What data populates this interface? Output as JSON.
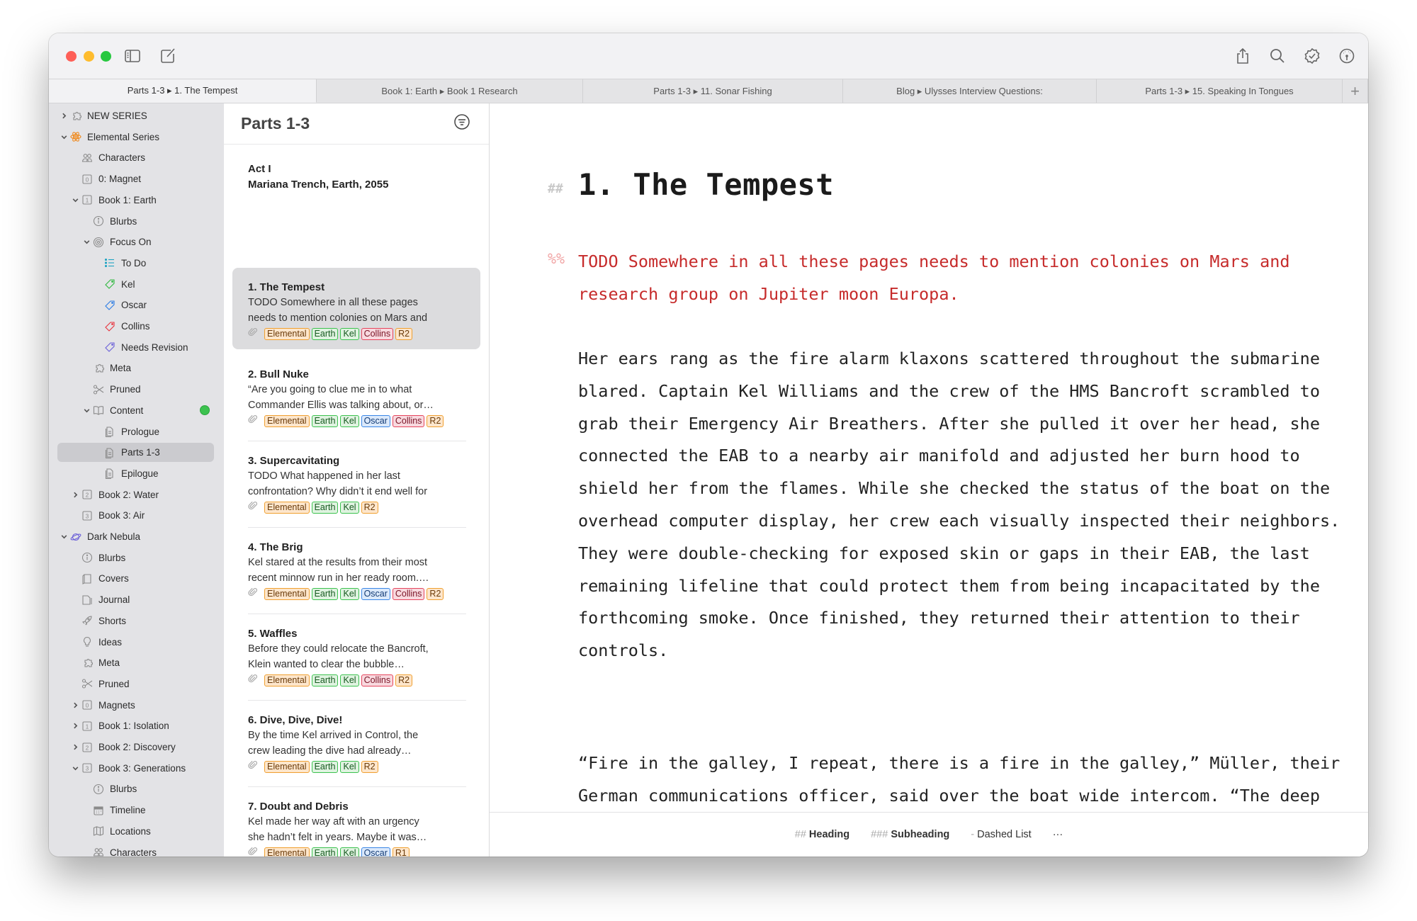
{
  "window": {
    "traffic_lights": [
      "close",
      "minimize",
      "zoom"
    ],
    "toolbar_left": [
      {
        "name": "sidebar-toggle-icon"
      },
      {
        "name": "new-sheet-icon"
      }
    ],
    "toolbar_right": [
      {
        "name": "share-icon"
      },
      {
        "name": "search-icon"
      },
      {
        "name": "review-badge-icon"
      },
      {
        "name": "dashboard-icon"
      }
    ]
  },
  "tabs": [
    {
      "label": "Parts 1-3 ▸ 1. The Tempest",
      "active": true
    },
    {
      "label": "Book 1: Earth ▸ Book 1 Research",
      "active": false
    },
    {
      "label": "Parts 1-3 ▸ 11. Sonar Fishing",
      "active": false
    },
    {
      "label": "Blog ▸ Ulysses Interview Questions:",
      "active": false
    },
    {
      "label": "Parts 1-3 ▸ 15. Speaking In Tongues",
      "active": false
    }
  ],
  "tab_add": "+",
  "sidebar": {
    "items": [
      {
        "label": "NEW SERIES",
        "level": 0,
        "chevron": "right",
        "icon": "puzzle",
        "color": "#8a8a8a"
      },
      {
        "label": "Elemental Series",
        "level": 0,
        "chevron": "down",
        "icon": "atom",
        "color": "#f08a1e"
      },
      {
        "label": "Characters",
        "level": 1,
        "chevron": "",
        "icon": "people",
        "color": "#8a8a8a"
      },
      {
        "label": "0: Magnet",
        "level": 1,
        "chevron": "",
        "icon": "box-0",
        "color": "#8a8a8a"
      },
      {
        "label": "Book 1: Earth",
        "level": 1,
        "chevron": "down",
        "icon": "box-1",
        "color": "#8a8a8a"
      },
      {
        "label": "Blurbs",
        "level": 2,
        "chevron": "",
        "icon": "info",
        "color": "#8a8a8a"
      },
      {
        "label": "Focus On",
        "level": 2,
        "chevron": "down",
        "icon": "target",
        "color": "#8a8a8a"
      },
      {
        "label": "To Do",
        "level": 3,
        "chevron": "",
        "icon": "list",
        "color": "#1fa3c2"
      },
      {
        "label": "Kel",
        "level": 3,
        "chevron": "",
        "icon": "tag",
        "color": "#2db83d"
      },
      {
        "label": "Oscar",
        "level": 3,
        "chevron": "",
        "icon": "tag",
        "color": "#2a7be4"
      },
      {
        "label": "Collins",
        "level": 3,
        "chevron": "",
        "icon": "tag",
        "color": "#e8333d"
      },
      {
        "label": "Needs Revision",
        "level": 3,
        "chevron": "",
        "icon": "tag",
        "color": "#6a5fd8"
      },
      {
        "label": "Meta",
        "level": 2,
        "chevron": "",
        "icon": "puzzle",
        "color": "#8a8a8a"
      },
      {
        "label": "Pruned",
        "level": 2,
        "chevron": "",
        "icon": "scissors",
        "color": "#8a8a8a"
      },
      {
        "label": "Content",
        "level": 2,
        "chevron": "down",
        "icon": "book",
        "color": "#8a8a8a",
        "status_dot": "#3cc24f"
      },
      {
        "label": "Prologue",
        "level": 3,
        "chevron": "",
        "icon": "doc",
        "color": "#8a8a8a"
      },
      {
        "label": "Parts 1-3",
        "level": 3,
        "chevron": "",
        "icon": "doc",
        "color": "#8a8a8a",
        "selected": true
      },
      {
        "label": "Epilogue",
        "level": 3,
        "chevron": "",
        "icon": "doc",
        "color": "#8a8a8a"
      },
      {
        "label": "Book 2: Water",
        "level": 1,
        "chevron": "right",
        "icon": "box-2",
        "color": "#8a8a8a"
      },
      {
        "label": "Book 3: Air",
        "level": 1,
        "chevron": "",
        "icon": "box-3",
        "color": "#8a8a8a"
      },
      {
        "label": "Dark Nebula",
        "level": 0,
        "chevron": "down",
        "icon": "planet",
        "color": "#6a5fd8"
      },
      {
        "label": "Blurbs",
        "level": 1,
        "chevron": "",
        "icon": "info",
        "color": "#8a8a8a"
      },
      {
        "label": "Covers",
        "level": 1,
        "chevron": "",
        "icon": "cover",
        "color": "#8a8a8a"
      },
      {
        "label": "Journal",
        "level": 1,
        "chevron": "",
        "icon": "journal",
        "color": "#8a8a8a"
      },
      {
        "label": "Shorts",
        "level": 1,
        "chevron": "",
        "icon": "rocket",
        "color": "#8a8a8a"
      },
      {
        "label": "Ideas",
        "level": 1,
        "chevron": "",
        "icon": "bulb",
        "color": "#8a8a8a"
      },
      {
        "label": "Meta",
        "level": 1,
        "chevron": "",
        "icon": "puzzle",
        "color": "#8a8a8a"
      },
      {
        "label": "Pruned",
        "level": 1,
        "chevron": "",
        "icon": "scissors",
        "color": "#8a8a8a"
      },
      {
        "label": "Magnets",
        "level": 1,
        "chevron": "right",
        "icon": "box-0",
        "color": "#8a8a8a"
      },
      {
        "label": "Book 1: Isolation",
        "level": 1,
        "chevron": "right",
        "icon": "box-1",
        "color": "#8a8a8a"
      },
      {
        "label": "Book 2: Discovery",
        "level": 1,
        "chevron": "right",
        "icon": "box-2",
        "color": "#8a8a8a"
      },
      {
        "label": "Book 3: Generations",
        "level": 1,
        "chevron": "down",
        "icon": "box-3",
        "color": "#8a8a8a"
      },
      {
        "label": "Blurbs",
        "level": 2,
        "chevron": "",
        "icon": "info",
        "color": "#8a8a8a"
      },
      {
        "label": "Timeline",
        "level": 2,
        "chevron": "",
        "icon": "calendar",
        "color": "#8a8a8a"
      },
      {
        "label": "Locations",
        "level": 2,
        "chevron": "",
        "icon": "map",
        "color": "#8a8a8a"
      },
      {
        "label": "Characters",
        "level": 2,
        "chevron": "",
        "icon": "people",
        "color": "#8a8a8a"
      }
    ]
  },
  "sheet_list": {
    "title": "Parts 1-3",
    "act": {
      "line1": "Act I",
      "line2": "Mariana Trench, Earth, 2055"
    },
    "sheets": [
      {
        "title": "1. The Tempest",
        "line1": "TODO Somewhere in all these pages",
        "line2": "needs to mention colonies on Mars and",
        "tags": [
          "Elemental",
          "Earth",
          "Kel",
          "Collins",
          "R2"
        ],
        "selected": true
      },
      {
        "title": "2. Bull Nuke",
        "line1": "“Are you going to clue me in to what",
        "line2": "Commander Ellis was talking about, or…",
        "tags": [
          "Elemental",
          "Earth",
          "Kel",
          "Oscar",
          "Collins",
          "R2"
        ]
      },
      {
        "title": "3. Supercavitating",
        "line1": "TODO What happened in her last",
        "line2": "confrontation? Why didn’t it end well for",
        "tags": [
          "Elemental",
          "Earth",
          "Kel",
          "R2"
        ]
      },
      {
        "title": "4. The Brig",
        "line1": "Kel stared at the results from their most",
        "line2": "recent minnow run in her ready room.…",
        "tags": [
          "Elemental",
          "Earth",
          "Kel",
          "Oscar",
          "Collins",
          "R2"
        ]
      },
      {
        "title": "5. Waffles",
        "line1": "Before they could relocate the Bancroft,",
        "line2": "Klein wanted to clear the bubble…",
        "tags": [
          "Elemental",
          "Earth",
          "Kel",
          "Collins",
          "R2"
        ]
      },
      {
        "title": "6. Dive, Dive, Dive!",
        "line1": "By the time Kel arrived in Control, the",
        "line2": "crew leading the dive had already…",
        "tags": [
          "Elemental",
          "Earth",
          "Kel",
          "R2"
        ]
      },
      {
        "title": "7. Doubt and Debris",
        "line1": "Kel made her way aft with an urgency",
        "line2": "she hadn’t felt in years. Maybe it was…",
        "tags": [
          "Elemental",
          "Earth",
          "Kel",
          "Oscar",
          "R1"
        ]
      }
    ],
    "tag_colors": {
      "Elemental": {
        "border": "#f0a030",
        "bg": "#fde6cc",
        "text": "#6a3a08"
      },
      "Earth": {
        "border": "#3cc24f",
        "bg": "#dff3e0",
        "text": "#175a20"
      },
      "Kel": {
        "border": "#3cc24f",
        "bg": "#dff3e0",
        "text": "#175a20"
      },
      "Oscar": {
        "border": "#3a86e6",
        "bg": "#dbe9fb",
        "text": "#143c75"
      },
      "Collins": {
        "border": "#e5455d",
        "bg": "#f8d9df",
        "text": "#7a1426"
      },
      "R2": {
        "border": "#f0a030",
        "bg": "#fde6cc",
        "text": "#6a3a08"
      },
      "R1": {
        "border": "#f0a030",
        "bg": "#fde6cc",
        "text": "#6a3a08"
      }
    }
  },
  "editor": {
    "heading_marker": "##",
    "heading": "1. The Tempest",
    "comment_marker": "%%",
    "comment": "TODO Somewhere in all these pages needs to mention colonies on Mars and research group on Jupiter moon Europa.",
    "paragraphs": [
      "Her ears rang as the fire alarm klaxons scattered throughout the submarine blared. Captain Kel Williams and the crew of the HMS Bancroft scrambled to grab their Emergency Air Breathers. After she pulled it over her head, she connected the EAB to a nearby air manifold and adjusted her burn hood to shield her from the flames. While she checked the status of the boat on the overhead computer display, her crew each visually inspected their neighbors. They were double-checking for exposed skin or gaps in their EAB, the last remaining lifeline that could protect them from being incapacitated by the forthcoming smoke. Once finished, they returned their attention to their controls.",
      "“Fire in the galley, I repeat, there is a fire in the galley,” Müller, their German communications officer, said over the boat wide intercom. “The deep fat friers appear to have ignited. Rig for fire and general"
    ],
    "format_bar": [
      {
        "marker": "##",
        "label": "Heading",
        "bold": true
      },
      {
        "marker": "###",
        "label": "Subheading",
        "bold": true
      },
      {
        "marker": "-",
        "label": "Dashed List",
        "bold": false
      },
      {
        "marker": "",
        "label": "···",
        "bold": false
      }
    ]
  }
}
